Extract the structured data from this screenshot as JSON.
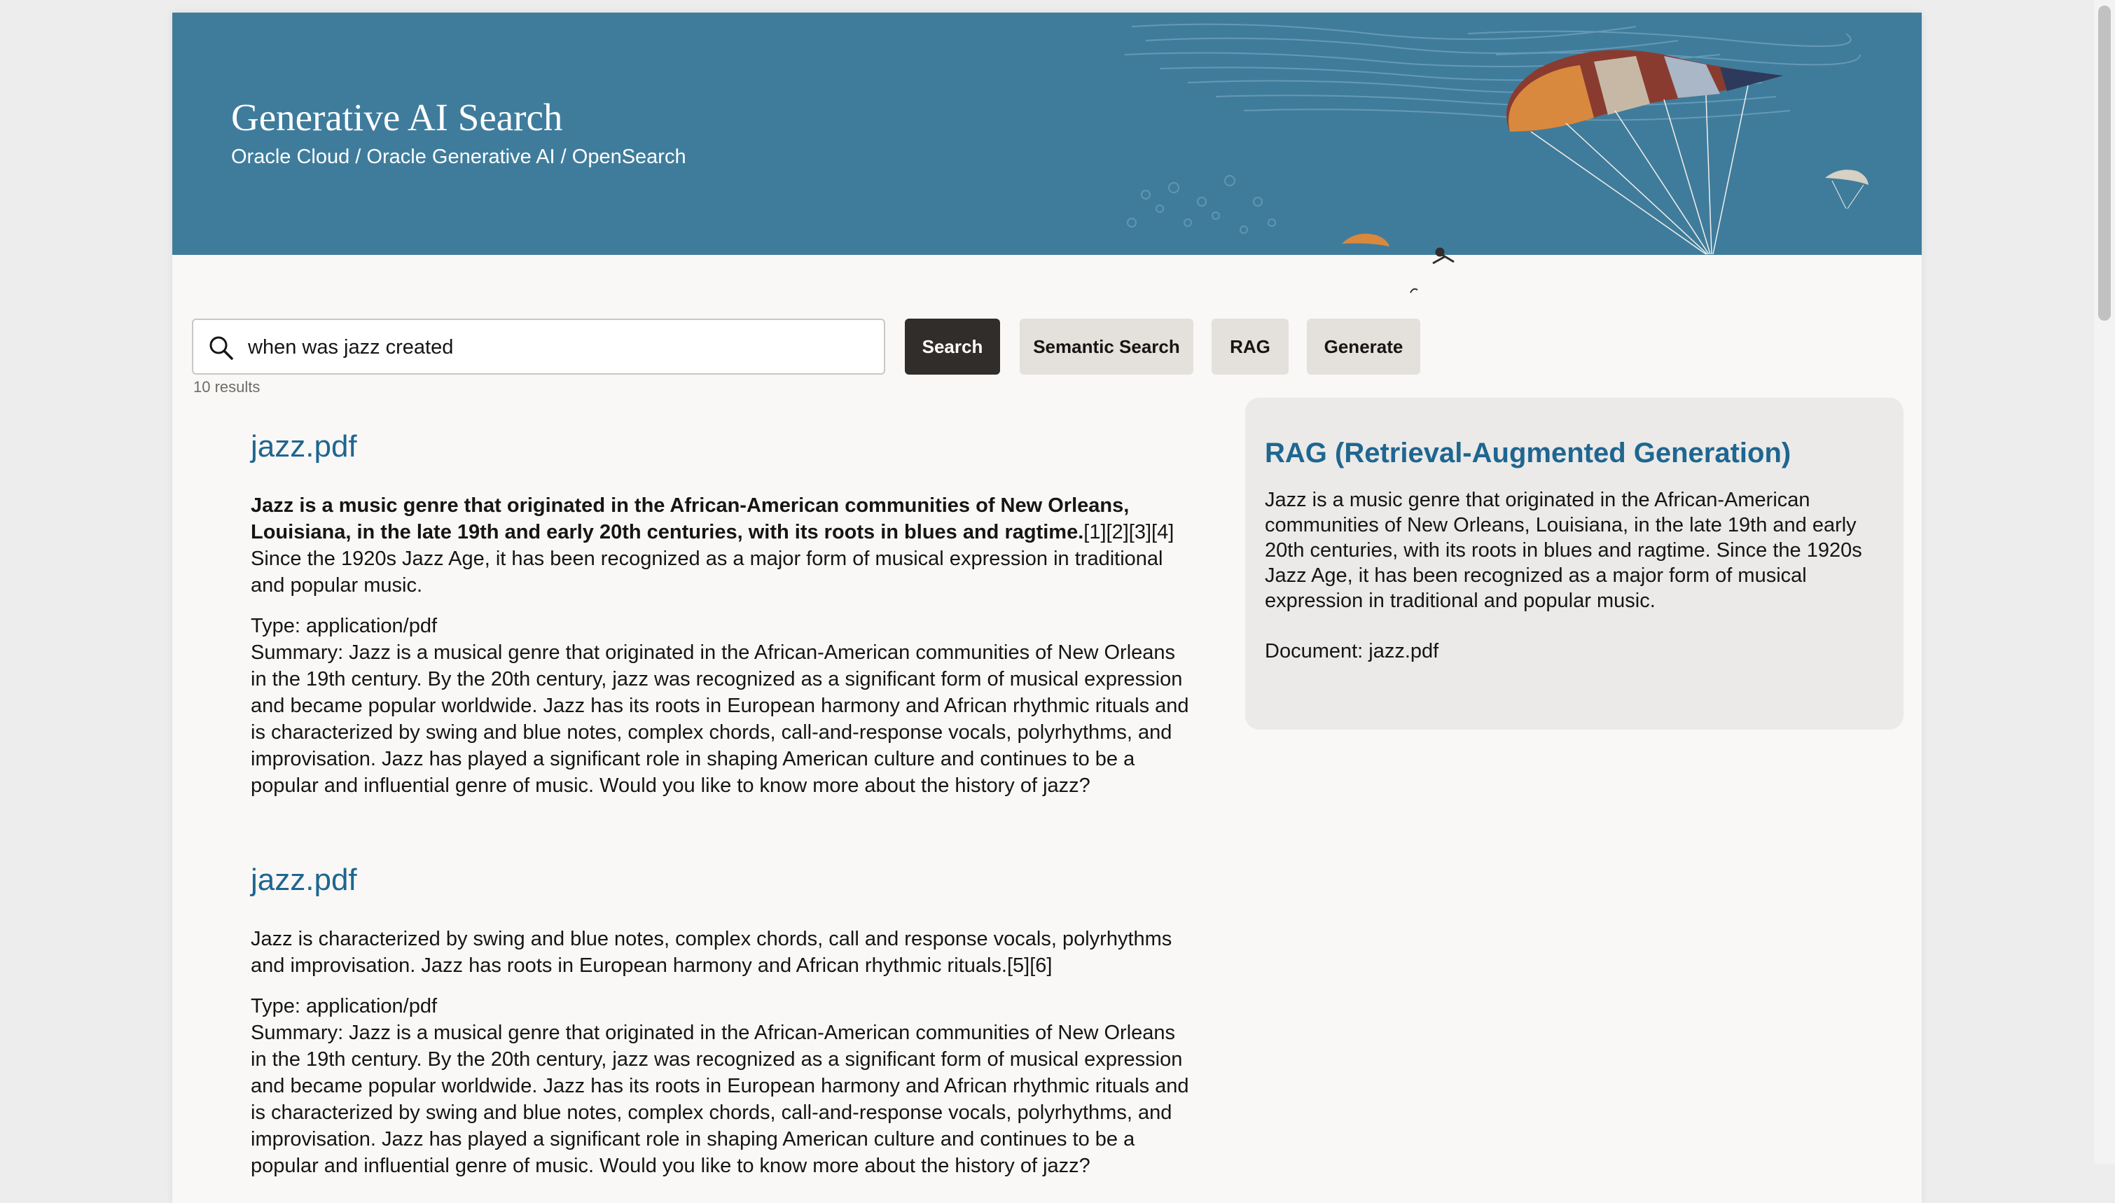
{
  "banner": {
    "title": "Generative AI Search",
    "breadcrumb": "Oracle Cloud / Oracle Generative AI / OpenSearch"
  },
  "search": {
    "value": "when was jazz created",
    "placeholder": "",
    "buttons": {
      "search": "Search",
      "semantic": "Semantic Search",
      "rag": "RAG",
      "generate": "Generate"
    },
    "result_count": "10 results"
  },
  "results": [
    {
      "title": "jazz.pdf",
      "highlight_bold": "Jazz is a music genre that originated in the African-American communities of New Orleans, Louisiana, in the late 19th and early 20th centuries, with its roots in blues and ragtime.",
      "highlight_rest": "[1][2][3][4] Since the 1920s Jazz Age, it has been recognized as a major form of musical expression in traditional and popular music.",
      "type": "Type: application/pdf",
      "summary": "Summary: Jazz is a musical genre that originated in the African-American communities of New Orleans in the 19th century. By the 20th century, jazz was recognized as a significant form of musical expression and became popular worldwide. Jazz has its roots in European harmony and African rhythmic rituals and is characterized by swing and blue notes, complex chords, call-and-response vocals, polyrhythms, and improvisation. Jazz has played a significant role in shaping American culture and continues to be a popular and influential genre of music. Would you like to know more about the history of jazz?"
    },
    {
      "title": "jazz.pdf",
      "highlight_bold": "",
      "highlight_rest": "Jazz is characterized by swing and blue notes, complex chords, call and response vocals, polyrhythms and improvisation. Jazz has roots in European harmony and African rhythmic rituals.[5][6]",
      "type": "Type: application/pdf",
      "summary": "Summary: Jazz is a musical genre that originated in the African-American communities of New Orleans in the 19th century. By the 20th century, jazz was recognized as a significant form of musical expression and became popular worldwide. Jazz has its roots in European harmony and African rhythmic rituals and is characterized by swing and blue notes, complex chords, call-and-response vocals, polyrhythms, and improvisation. Jazz has played a significant role in shaping American culture and continues to be a popular and influential genre of music. Would you like to know more about the history of jazz?"
    }
  ],
  "rag": {
    "title": "RAG (Retrieval-Augmented Generation)",
    "text": "Jazz is a music genre that originated in the African-American communities of New Orleans, Louisiana, in the late 19th and early 20th centuries, with its roots in blues and ragtime. Since the 1920s Jazz Age, it has been recognized as a major form of musical expression in traditional and popular music.",
    "document": "Document: jazz.pdf"
  },
  "colors": {
    "banner": "#3f7c9c",
    "link": "#1f6690",
    "primary_button": "#312d2a",
    "secondary_button": "#e4e1dd",
    "panel": "#ebeae8"
  },
  "icons": [
    "search-icon",
    "parachute-illustration"
  ]
}
